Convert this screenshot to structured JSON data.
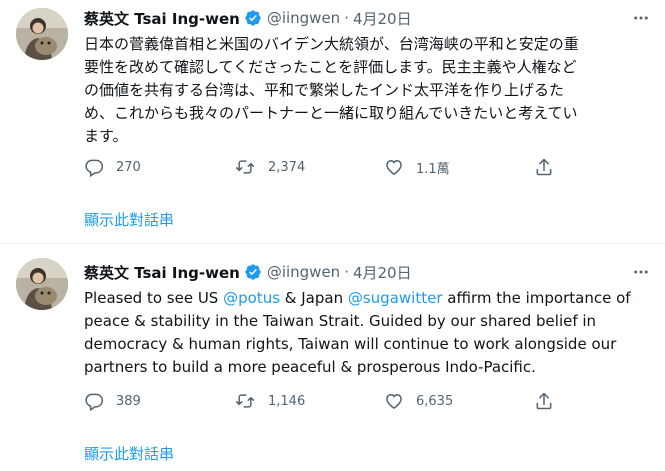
{
  "tweets": [
    {
      "display_name": "蔡英文 Tsai Ing-wen",
      "handle": "@iingwen",
      "separator": "·",
      "date": "4月20日",
      "text_lines": [
        "日本の菅義偉首相と米国のバイデン大統領が、台湾海峡の平和と安定の重",
        "要性を改めて確認してくださったことを評価します。民主主義や人権など",
        "の価値を共有する台湾は、平和で繁栄したインド太平洋を作り上げるた",
        "め、これからも我々のパートナーと一緒に取り組んでいきたいと考えてい",
        "ます。"
      ],
      "replies": "270",
      "retweets": "2,374",
      "likes": "1.1萬",
      "thread_link": "顯示此對話串"
    },
    {
      "display_name": "蔡英文 Tsai Ing-wen",
      "handle": "@iingwen",
      "separator": "·",
      "date": "4月20日",
      "text_parts": {
        "p1": "Pleased to see US ",
        "m1": "@potus",
        "p2": " & Japan ",
        "m2": "@sugawitter",
        "p3": " affirm the importance of",
        "line2": "peace & stability in the Taiwan Strait. Guided by our shared belief in",
        "line3": "democracy & human rights, Taiwan will continue to work alongside our",
        "line4": "partners to build a more peaceful & prosperous Indo-Pacific."
      },
      "replies": "389",
      "retweets": "1,146",
      "likes": "6,635",
      "thread_link": "顯示此對話串"
    }
  ],
  "colors": {
    "link": "#1d9bf0",
    "muted": "#536471",
    "text": "#0f1419",
    "verified": "#1d9bf0",
    "divider": "#eff3f4"
  },
  "icons": [
    "verified-badge-icon",
    "more-icon",
    "reply-icon",
    "retweet-icon",
    "like-icon",
    "share-icon"
  ]
}
